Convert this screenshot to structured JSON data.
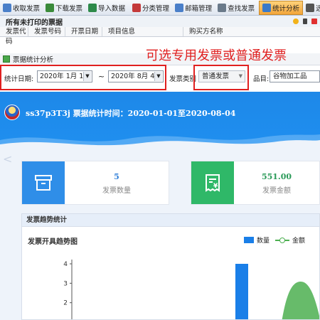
{
  "toolbar": {
    "items": [
      {
        "label": "收取发票",
        "icon": "receive-icon",
        "color": "#4a7fc9"
      },
      {
        "label": "下载发票",
        "icon": "download-icon",
        "color": "#3b8b3b"
      },
      {
        "label": "导入数据",
        "icon": "import-icon",
        "color": "#2e8a4a"
      },
      {
        "label": "分类管理",
        "icon": "category-icon",
        "color": "#c43a3a"
      },
      {
        "label": "邮箱管理",
        "icon": "mailbox-icon",
        "color": "#4a7fc9"
      },
      {
        "label": "查找发票",
        "icon": "find-icon",
        "color": "#6a7a8a"
      },
      {
        "label": "统计分析",
        "icon": "chart-icon",
        "color": "#3a7ac9",
        "active": true
      },
      {
        "label": "选项设置",
        "icon": "settings-icon",
        "color": "#555555"
      }
    ]
  },
  "list": {
    "title": "所有未打印的票据",
    "columns": [
      "发票代码",
      "发票号码",
      "开票日期",
      "项目信息",
      "购买方名称"
    ]
  },
  "window": {
    "title": "票据统计分析"
  },
  "annotation": "可选专用发票或普通发票",
  "filter": {
    "date_label": "统计日期:",
    "start_date": "2020年 1月 1日",
    "tilde": "~",
    "end_date": "2020年 8月 4日",
    "type_label": "发票类别",
    "type_value": "普通发票",
    "product_label": "品目:",
    "product_value": "谷物加工品"
  },
  "banner": {
    "text": "ss37p3T3j 票据统计时间：2020-01-01至2020-08-04"
  },
  "cards": [
    {
      "value": "5",
      "label": "发票数量",
      "color": "#2f8ee8",
      "value_color": "#2f7fd8"
    },
    {
      "value": "551.00",
      "label": "发票金额",
      "color": "#2fb868",
      "value_color": "#2a9a58"
    }
  ],
  "panel": {
    "title": "发票趋势统计"
  },
  "chart_data": {
    "type": "bar",
    "title": "发票开具趋势图",
    "series": [
      {
        "name": "数量",
        "color": "#1a7fe8",
        "values": [
          4
        ]
      },
      {
        "name": "金额",
        "color": "#4caf50",
        "values": [
          400
        ]
      }
    ],
    "ylim": [
      1,
      4
    ],
    "yticks": [
      "4",
      "3",
      "2"
    ],
    "legend_position": "top-right"
  }
}
